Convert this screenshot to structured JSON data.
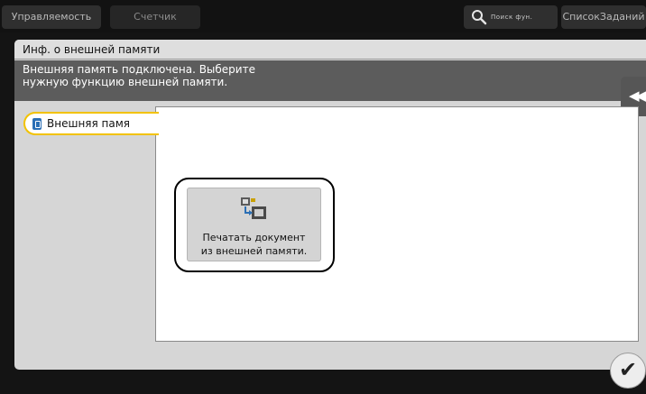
{
  "topbar": {
    "tabs": [
      {
        "label": "Управляемость"
      },
      {
        "label": "Счетчик"
      }
    ],
    "search_label": "Поиск фун.",
    "job_list_label": "СписокЗаданий"
  },
  "panel": {
    "title": "Инф. о внешней памяти",
    "message_line1": "Внешняя память подключена. Выберите",
    "message_line2": "нужную функцию внешней памяти.",
    "collapse_glyph": "◀◀",
    "side_tab_label": "Внешняя памя",
    "function_button": {
      "line1": "Печатать документ",
      "line2": "из внешней памяти."
    }
  },
  "ok_glyph": "✔",
  "colors": {
    "accent": "#f2c200",
    "usb_icon": "#2b6fb5"
  },
  "icons": [
    "search-icon",
    "usb-memory-icon",
    "print-from-memory-icon",
    "collapse-arrows-icon",
    "checkmark-icon"
  ]
}
